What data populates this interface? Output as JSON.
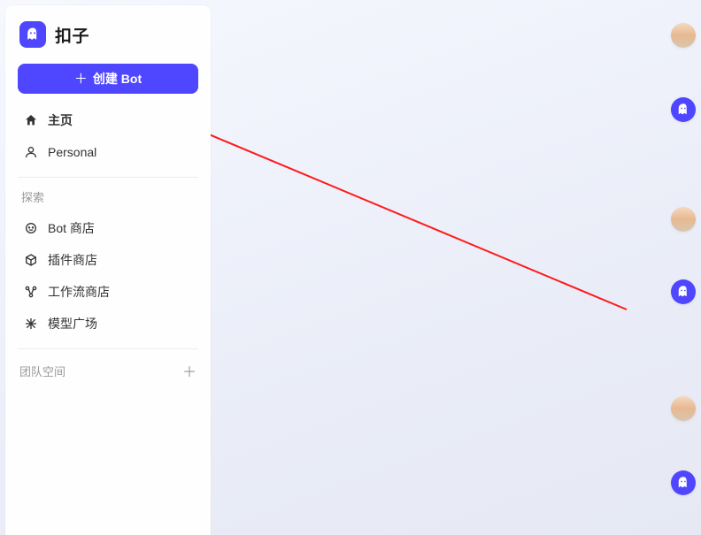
{
  "brand": {
    "name": "扣子"
  },
  "create_button": {
    "label": "创建 Bot"
  },
  "nav": {
    "items": [
      {
        "label": "主页"
      },
      {
        "label": "Personal"
      }
    ]
  },
  "explore": {
    "title": "探索",
    "items": [
      {
        "label": "Bot 商店"
      },
      {
        "label": "插件商店"
      },
      {
        "label": "工作流商店"
      },
      {
        "label": "模型广场"
      }
    ]
  },
  "team": {
    "title": "团队空间"
  }
}
